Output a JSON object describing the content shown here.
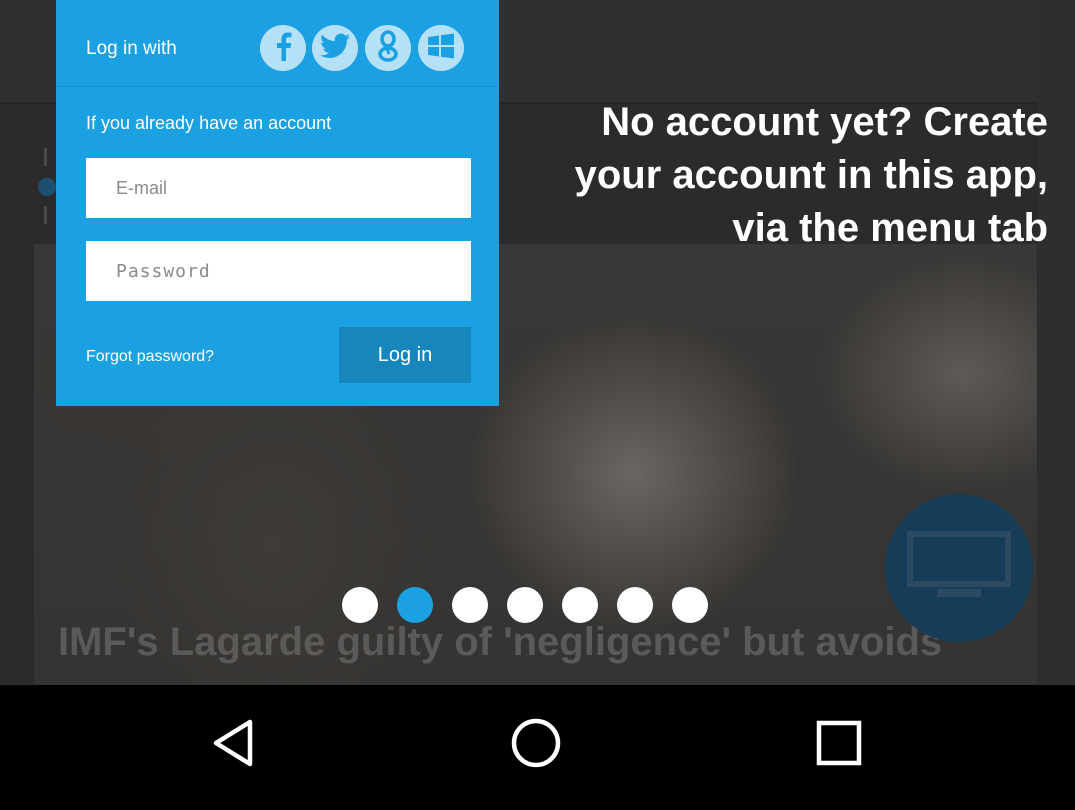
{
  "colors": {
    "accent": "#1ba1e2",
    "panel_button": "#1686bc",
    "social_bg": "#b5e1f6",
    "fab": "#163c57"
  },
  "background_app": {
    "headline": "IMF's Lagarde guilty of 'negligence' but avoids",
    "fab_icon": "tv-icon"
  },
  "coach_mark": {
    "line1": "No account yet? Create",
    "line2": "your account in this app,",
    "line3": "via the menu tab"
  },
  "login": {
    "login_with_label": "Log in with",
    "social_icons": [
      "facebook-icon",
      "twitter-icon",
      "google-plus-icon",
      "windows-icon"
    ],
    "already_label": "If you already have an account",
    "email_placeholder": "E-mail",
    "password_placeholder": "Password",
    "forgot_label": "Forgot password?",
    "login_button": "Log in"
  },
  "pager": {
    "count": 7,
    "active_index": 1
  },
  "navbar": {
    "icons": [
      "back-icon",
      "home-icon",
      "recents-icon"
    ]
  }
}
